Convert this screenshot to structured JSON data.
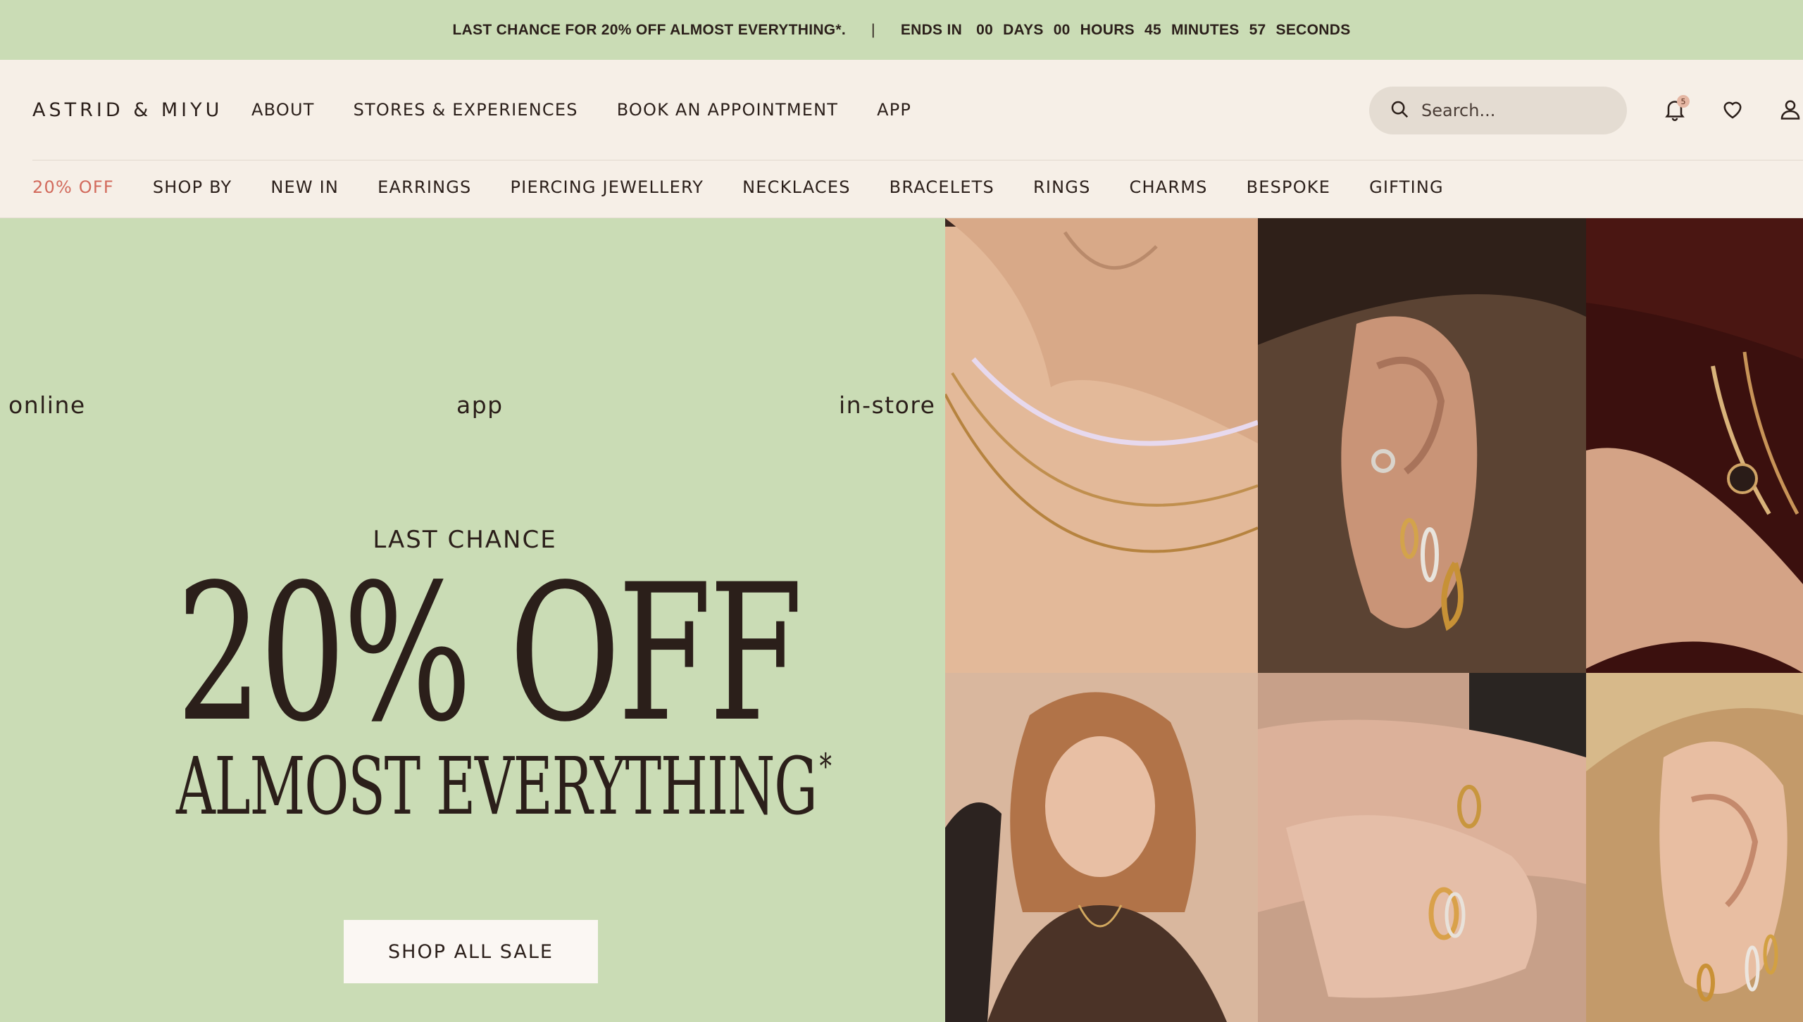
{
  "promo": {
    "message": "LAST CHANCE FOR 20% OFF ALMOST EVERYTHING*.",
    "separator": "|",
    "ends_in": "ENDS IN",
    "days_value": "00",
    "days_label": "DAYS",
    "hours_value": "00",
    "hours_label": "HOURS",
    "minutes_value": "45",
    "minutes_label": "MINUTES",
    "seconds_value": "57",
    "seconds_label": "SECONDS"
  },
  "header": {
    "logo": "ASTRID & MIYU",
    "nav": [
      "ABOUT",
      "STORES & EXPERIENCES",
      "BOOK AN APPOINTMENT",
      "APP"
    ],
    "search_placeholder": "Search...",
    "notification_count": "5",
    "icons": [
      "search-icon",
      "bell-icon",
      "heart-icon",
      "user-icon"
    ]
  },
  "categories": [
    "20% OFF",
    "SHOP BY",
    "NEW IN",
    "EARRINGS",
    "PIERCING JEWELLERY",
    "NECKLACES",
    "BRACELETS",
    "RINGS",
    "CHARMS",
    "BESPOKE",
    "GIFTING"
  ],
  "hero": {
    "channels": [
      "online",
      "app",
      "in-store"
    ],
    "kicker": "LAST CHANCE",
    "title": "20% OFF",
    "subtitle": "ALMOST EVERYTHING",
    "subtitle_mark": "*",
    "cta": "SHOP ALL SALE"
  },
  "colors": {
    "promo_bg": "#cadcb5",
    "header_bg": "#f6efe7",
    "sale_accent": "#d26a5c",
    "text": "#2b1f1a"
  }
}
